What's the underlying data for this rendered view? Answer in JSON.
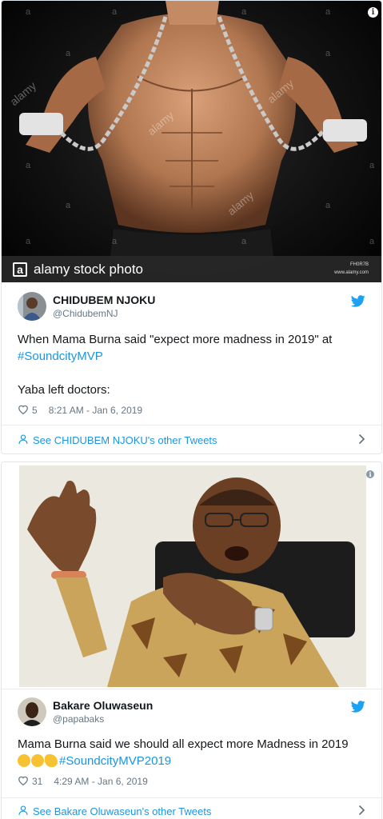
{
  "tweets": [
    {
      "photo": {
        "watermark_brand": "alamy",
        "watermark_tile": "a",
        "stock_bar_logo": "a",
        "stock_bar_text": "alamy stock photo",
        "stock_id": "FH0R7B",
        "stock_site": "www.alamy.com",
        "info_icon": "i"
      },
      "author": {
        "display_name": "CHIDUBEM NJOKU",
        "handle": "@ChidubemNJ"
      },
      "text_line1": "When Mama Burna said \"expect more madness in 2019\" at",
      "hashtag": "#SoundcityMVP",
      "text_line2": "Yaba left doctors:",
      "likes": "5",
      "timestamp": "8:21 AM - Jan 6, 2019",
      "footer_link": "See CHIDUBEM NJOKU's other Tweets",
      "colors": {
        "link": "#1b95e0",
        "meta": "#657786",
        "bird": "#1da1f2"
      }
    },
    {
      "photo": {
        "info_icon": "i"
      },
      "author": {
        "display_name": "Bakare Oluwaseun",
        "handle": "@papabaks"
      },
      "text_line1": "Mama Burna said we should all expect more Madness in 2019",
      "emojis": [
        "face-with-monocle",
        "thinking-face",
        "flexed-biceps"
      ],
      "hashtag": "#SoundcityMVP2019",
      "likes": "31",
      "timestamp": "4:29 AM - Jan 6, 2019",
      "footer_link": "See Bakare Oluwaseun's other Tweets"
    }
  ]
}
